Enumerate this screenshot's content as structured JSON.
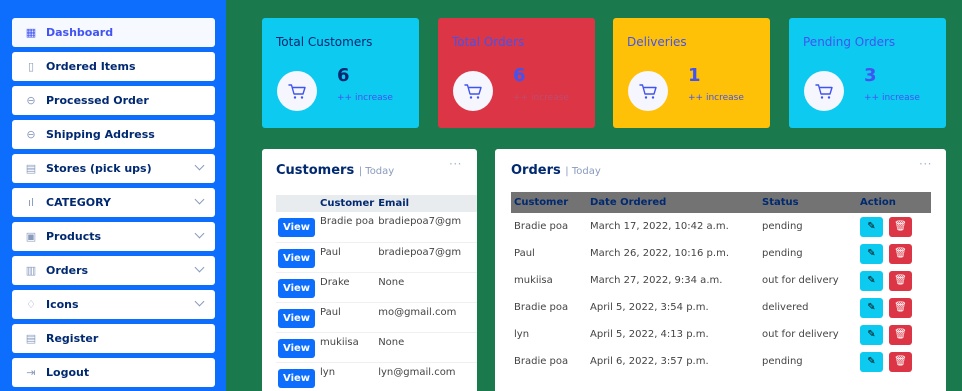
{
  "sidebar": {
    "items": [
      {
        "label": "Dashboard",
        "icon": "grid-icon",
        "glyph": "▦",
        "active": true,
        "has_chevron": false
      },
      {
        "label": "Ordered Items",
        "icon": "file-icon",
        "glyph": "▯",
        "active": false,
        "has_chevron": false
      },
      {
        "label": "Processed Order",
        "icon": "circle-minus-icon",
        "glyph": "⊖",
        "active": false,
        "has_chevron": false
      },
      {
        "label": "Shipping Address",
        "icon": "circle-minus-icon",
        "glyph": "⊖",
        "active": false,
        "has_chevron": false
      },
      {
        "label": "Stores (pick ups)",
        "icon": "store-icon",
        "glyph": "▤",
        "active": false,
        "has_chevron": true
      },
      {
        "label": "CATEGORY",
        "icon": "bar-chart-icon",
        "glyph": "ıl",
        "active": false,
        "has_chevron": true
      },
      {
        "label": "Products",
        "icon": "card-text-icon",
        "glyph": "▣",
        "active": false,
        "has_chevron": true
      },
      {
        "label": "Orders",
        "icon": "list-box-icon",
        "glyph": "▥",
        "active": false,
        "has_chevron": true
      },
      {
        "label": "Icons",
        "icon": "gem-icon",
        "glyph": "♢",
        "active": false,
        "has_chevron": true
      },
      {
        "label": "Register",
        "icon": "card-list-icon",
        "glyph": "▤",
        "active": false,
        "has_chevron": false
      },
      {
        "label": "Logout",
        "icon": "logout-icon",
        "glyph": "⇥",
        "active": false,
        "has_chevron": false
      }
    ]
  },
  "stats": [
    {
      "title": "Total Customers",
      "value": "6",
      "increase": "++ increase",
      "bg": "#0dcaf0",
      "title_color": "#012970",
      "value_color": "#012970",
      "inc_color": "#4154f1"
    },
    {
      "title": "Total Orders",
      "value": "6",
      "increase": "++ increase",
      "bg": "#dc3545",
      "title_color": "#4154f1",
      "value_color": "#4154f1",
      "inc_color": "#bf4b6e"
    },
    {
      "title": "Deliveries",
      "value": "1",
      "increase": "++ increase",
      "bg": "#ffc107",
      "title_color": "#4154f1",
      "value_color": "#4154f1",
      "inc_color": "#4154f1"
    },
    {
      "title": "Pending Orders",
      "value": "3",
      "increase": "++ increase",
      "bg": "#0dcaf0",
      "title_color": "#4154f1",
      "value_color": "#4154f1",
      "inc_color": "#4154f1"
    }
  ],
  "customers": {
    "title": "Customers",
    "subtitle": "| Today",
    "dots": "···",
    "columns": [
      "Customer",
      "Email"
    ],
    "view_label": "View",
    "rows": [
      {
        "name": "Bradie poa",
        "email": "bradiepoa7@gm"
      },
      {
        "name": "Paul",
        "email": "bradiepoa7@gm"
      },
      {
        "name": "Drake",
        "email": "None"
      },
      {
        "name": "Paul",
        "email": "mo@gmail.com"
      },
      {
        "name": "mukiisa",
        "email": "None"
      },
      {
        "name": "lyn",
        "email": "lyn@gmail.com"
      }
    ]
  },
  "orders": {
    "title": "Orders",
    "subtitle": "| Today",
    "dots": "···",
    "columns": [
      "Customer",
      "Date Ordered",
      "Status",
      "Action"
    ],
    "edit_glyph": "✎",
    "delete_glyph": "🗑",
    "rows": [
      {
        "customer": "Bradie poa",
        "date": "March 17, 2022, 10:42 a.m.",
        "status": "pending"
      },
      {
        "customer": "Paul",
        "date": "March 26, 2022, 10:16 p.m.",
        "status": "pending"
      },
      {
        "customer": "mukiisa",
        "date": "March 27, 2022, 9:34 a.m.",
        "status": "out for delivery"
      },
      {
        "customer": "Bradie poa",
        "date": "April 5, 2022, 3:54 p.m.",
        "status": "delivered"
      },
      {
        "customer": "lyn",
        "date": "April 5, 2022, 4:13 p.m.",
        "status": "out for delivery"
      },
      {
        "customer": "Bradie poa",
        "date": "April 6, 2022, 3:57 p.m.",
        "status": "pending"
      }
    ]
  }
}
